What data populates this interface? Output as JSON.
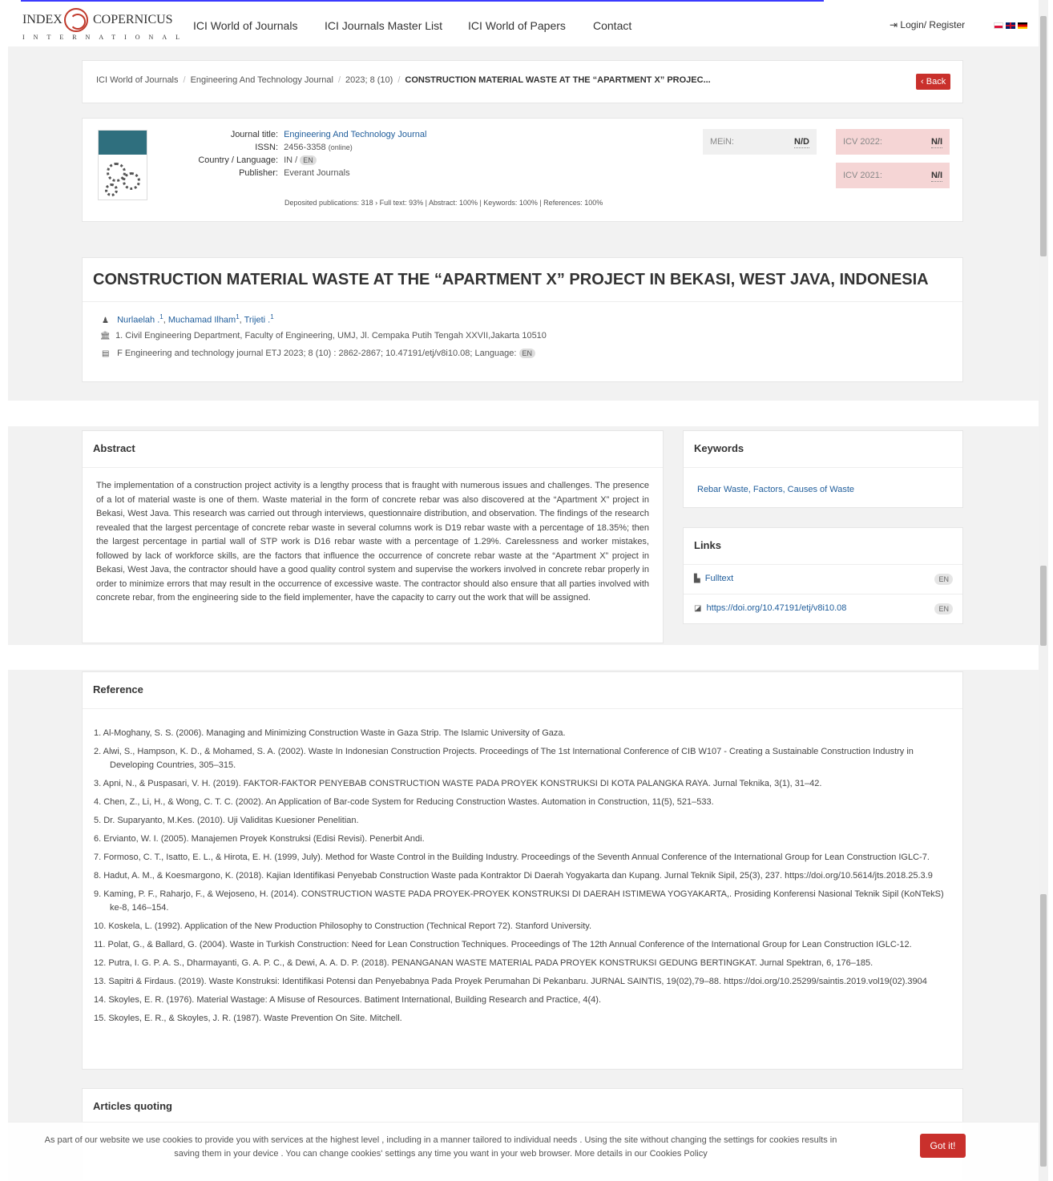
{
  "header": {
    "logo_word1": "INDEX",
    "logo_word2": "COPERNICUS",
    "logo_sub": "INTERNATIONAL",
    "nav": [
      "ICI World of Journals",
      "ICI Journals Master List",
      "ICI World of Papers",
      "Contact"
    ],
    "login": "Login/ Register"
  },
  "breadcrumb": {
    "items": [
      "ICI World of Journals",
      "Engineering And Technology Journal",
      "2023; 8 (10)"
    ],
    "current": "CONSTRUCTION MATERIAL WASTE AT THE “APARTMENT X” PROJEC...",
    "back_label": "Back"
  },
  "journal": {
    "title_label": "Journal title:",
    "title_value": "Engineering And Technology Journal",
    "issn_label": "ISSN:",
    "issn_value": "2456-3358",
    "issn_note": "(online)",
    "country_label": "Country / Language:",
    "country_value": "IN /",
    "language_tag": "EN",
    "publisher_label": "Publisher:",
    "publisher_value": "Everant Journals",
    "stats": "Deposited publications: 318 › Full text: 93% | Abstract: 100% | Keywords: 100% | References: 100%",
    "mein_label": "MEiN:",
    "mein_value": "N/D",
    "icv2022_label": "ICV 2022:",
    "icv2022_value": "N/I",
    "icv2021_label": "ICV 2021:",
    "icv2021_value": "N/I"
  },
  "article": {
    "title": "CONSTRUCTION MATERIAL WASTE AT THE “APARTMENT X” PROJECT IN BEKASI, WEST JAVA, INDONESIA",
    "authors": [
      {
        "name": "Nurlaelah .",
        "sup": "1"
      },
      {
        "name": "Muchamad Ilham",
        "sup": "1"
      },
      {
        "name": "Trijeti .",
        "sup": "1"
      }
    ],
    "affiliation": "1. Civil Engineering Department, Faculty of Engineering, UMJ, Jl. Cempaka Putih Tengah XXVII,Jakarta 10510",
    "citation": "F Engineering and technology journal ETJ 2023; 8 (10) : 2862-2867; 10.47191/etj/v8i10.08; Language:",
    "citation_lang": "EN"
  },
  "abstract": {
    "heading": "Abstract",
    "text": "The implementation of a construction project activity is a lengthy process that is fraught with numerous issues and challenges. The presence of a lot of material waste is one of them. Waste material in the form of concrete rebar was also discovered at the “Apartment X” project in Bekasi, West Java. This research was carried out through interviews, questionnaire distribution, and observation. The findings of the research revealed that the largest percentage of concrete rebar waste in several columns work is D19 rebar waste with a percentage of 18.35%; then the largest percentage in partial wall of STP work is D16 rebar waste with a percentage of 1.29%. Carelessness and worker mistakes, followed by lack of workforce skills, are the factors that influence the occurrence of concrete rebar waste at the “Apartment X” project in Bekasi, West Java, the contractor should have a good quality control system and supervise the workers involved in concrete rebar properly in order to minimize errors that may result in the occurrence of excessive waste. The contractor should also ensure that all parties involved with concrete rebar, from the engineering side to the field implementer, have the capacity to carry out the work that will be assigned."
  },
  "keywords": {
    "heading": "Keywords",
    "text": "Rebar Waste, Factors, Causes of Waste"
  },
  "links": {
    "heading": "Links",
    "items": [
      {
        "label": "Fulltext",
        "lang": "EN"
      },
      {
        "label": "https://doi.org/10.47191/etj/v8i10.08",
        "lang": "EN"
      }
    ]
  },
  "references": {
    "heading": "Reference",
    "items": [
      "1. Al-Moghany, S. S. (2006). Managing and Minimizing Construction Waste in Gaza Strip. The Islamic University of Gaza.",
      "2. Alwi, S., Hampson, K. D., & Mohamed, S. A. (2002). Waste In Indonesian Construction Projects. Proceedings of The 1st International Conference of CIB W107 - Creating a Sustainable Construction Industry in Developing Countries, 305–315.",
      "3. Apni, N., & Puspasari, V. H. (2019). FAKTOR-FAKTOR PENYEBAB CONSTRUCTION WASTE PADA PROYEK KONSTRUKSI DI KOTA PALANGKA RAYA. Jurnal Teknika, 3(1), 31–42.",
      "4. Chen, Z., Li, H., & Wong, C. T. C. (2002). An Application of Bar-code System for Reducing Construction Wastes. Automation in Construction, 11(5), 521–533.",
      "5. Dr. Suparyanto, M.Kes. (2010). Uji Validitas Kuesioner Penelitian.",
      "6. Ervianto, W. I. (2005). Manajemen Proyek Konstruksi (Edisi Revisi). Penerbit Andi.",
      "7. Formoso, C. T., Isatto, E. L., & Hirota, E. H. (1999, July). Method for Waste Control in the Building Industry. Proceedings of the Seventh Annual Conference of the International Group for Lean Construction IGLC-7.",
      "8. Hadut, A. M., & Koesmargono, K. (2018). Kajian Identifikasi Penyebab Construction Waste pada Kontraktor Di Daerah Yogyakarta dan Kupang. Jurnal Teknik Sipil, 25(3), 237. https://doi.org/10.5614/jts.2018.25.3.9",
      "9. Kaming, P. F., Raharjo, F., & Wejoseno, H. (2014). CONSTRUCTION WASTE PADA PROYEK-PROYEK KONSTRUKSI DI DAERAH ISTIMEWA YOGYAKARTA,. Prosiding Konferensi Nasional Teknik Sipil (KoNTekS) ke-8, 146–154.",
      "10. Koskela, L. (1992). Application of the New Production Philosophy to Construction (Technical Report 72). Stanford University.",
      "11. Polat, G., & Ballard, G. (2004). Waste in Turkish Construction: Need for Lean Construction Techniques. Proceedings of The 12th Annual Conference of the International Group for Lean Construction IGLC-12.",
      "12. Putra, I. G. P. A. S., Dharmayanti, G. A. P. C., & Dewi, A. A. D. P. (2018). PENANGANAN WASTE MATERIAL PADA PROYEK KONSTRUKSI GEDUNG BERTINGKAT. Jurnal Spektran, 6, 176–185.",
      "13. Sapitri & Firdaus. (2019). Waste Konstruksi: Identifikasi Potensi dan Penyebabnya Pada Proyek Perumahan Di Pekanbaru. JURNAL SAINTIS, 19(02),79–88. https://doi.org/10.25299/saintis.2019.vol19(02).3904",
      "14. Skoyles, E. R. (1976). Material Wastage: A Misuse of Resources. Batiment International, Building Research and Practice, 4(4).",
      "15. Skoyles, E. R., & Skoyles, J. R. (1987). Waste Prevention On Site. Mitchell."
    ]
  },
  "quoting": {
    "heading": "Articles quoting"
  },
  "cookie": {
    "text": "As part of our website we use cookies to provide you with services at the highest level , including in a manner tailored to individual needs . Using the site without changing the settings for cookies results in saving them in your device . You can change cookies' settings any time you want in your web browser. More details in our Cookies Policy",
    "button": "Got it!"
  },
  "colors": {
    "accent_red": "#c9302c",
    "link_blue": "#1f5d9b",
    "icv_bg": "#f5d5d5"
  }
}
